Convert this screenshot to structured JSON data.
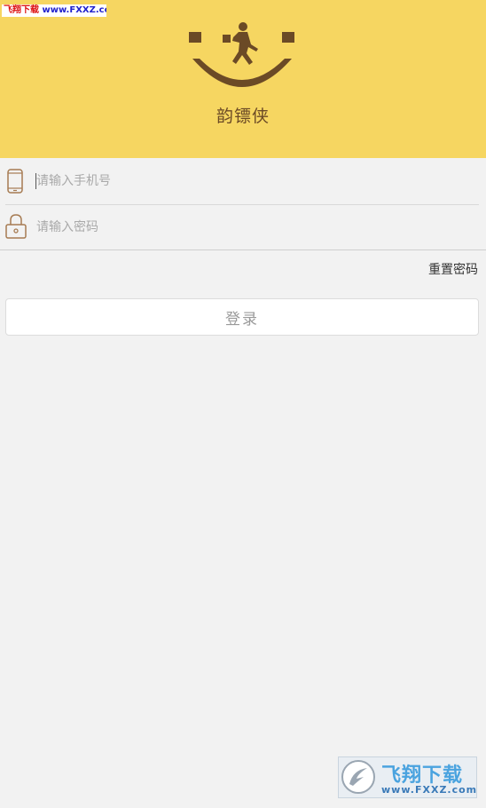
{
  "watermark_top": {
    "brand": "飞翔下载",
    "url": "www.FXXZ.com"
  },
  "header": {
    "app_name": "韵镖侠"
  },
  "form": {
    "phone": {
      "placeholder": "请输入手机号",
      "icon": "phone-icon"
    },
    "password": {
      "placeholder": "请输入密码",
      "icon": "lock-icon"
    }
  },
  "reset_password_label": "重置密码",
  "login_label": "登录",
  "watermark_bottom": {
    "title": "飞翔下载",
    "url": "www.FXXZ.com"
  },
  "colors": {
    "header_bg": "#f6d661",
    "logo_brown": "#6b4a26",
    "icon_outline": "#a67b52",
    "page_bg": "#f2f2f2"
  }
}
